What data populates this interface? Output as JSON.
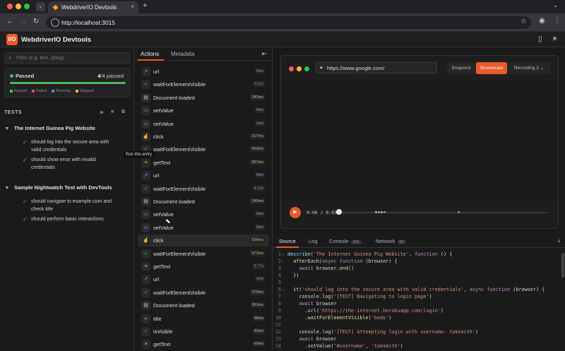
{
  "browser": {
    "tab_title": "WebdriverIO Devtools",
    "url": "http://localhost:3015",
    "new_tab": "+",
    "tab_close": "×",
    "tab_menu": "⌄"
  },
  "app": {
    "logo": "I/O",
    "title": "WebdriverIO Devtools"
  },
  "sidebar": {
    "filter_placeholder": "Filter (e.g. text, @tag)",
    "status": {
      "label": "Passed",
      "count_passed": "4",
      "count_total": "/4 passed",
      "progress": 1.0
    },
    "legend": [
      {
        "label": "Passed",
        "color": "#4cbb5c"
      },
      {
        "label": "Failed",
        "color": "#e04a4a"
      },
      {
        "label": "Running",
        "color": "#4a8be0"
      },
      {
        "label": "Skipped",
        "color": "#e0b84a"
      }
    ],
    "tests_header": "TESTS",
    "suites": [
      {
        "title": "The Internet Guinea Pig Website",
        "tests": [
          "should log into the secure area with valid credentials",
          "should show error with invalid credentials"
        ]
      },
      {
        "title": "Sample Nightwatch Test with DevTools",
        "tests": [
          "should navigate to example.com and check title",
          "should perform basic interactions"
        ]
      }
    ],
    "tooltip": "Run this entry"
  },
  "actions": {
    "tabs": [
      "Actions",
      "Metadata"
    ],
    "items": [
      {
        "name": "url",
        "dur": "0ms",
        "icon": "↗",
        "icon_color": "#6aa6ff",
        "dur_color": "#9a9a9a"
      },
      {
        "name": "waitForElementVisible",
        "dur": "4.11s",
        "icon": "✓",
        "icon_color": "#4cbb5c",
        "dur_color": "#e06060"
      },
      {
        "name": "Document loaded",
        "dur": "242ms",
        "icon": "▤",
        "icon_color": "#cccccc",
        "dur_color": "#8fd19e"
      },
      {
        "name": "setValue",
        "dur": "0ms",
        "icon": "▭",
        "icon_color": "#a78bfa",
        "dur_color": "#9a9a9a"
      },
      {
        "name": "setValue",
        "dur": "1ms",
        "icon": "▭",
        "icon_color": "#a78bfa",
        "dur_color": "#9a9a9a"
      },
      {
        "name": "click",
        "dur": "517ms",
        "icon": "☝",
        "icon_color": "#a78bfa",
        "dur_color": "#e6a16a"
      },
      {
        "name": "waitForElementVisible",
        "dur": "683ms",
        "icon": "✓",
        "icon_color": "#4cbb5c",
        "dur_color": "#e6a16a"
      },
      {
        "name": "getText",
        "dur": "867ms",
        "icon": "≡",
        "icon_color": "#e0b84a",
        "dur_color": "#e6a16a"
      },
      {
        "name": "url",
        "dur": "0ms",
        "icon": "↗",
        "icon_color": "#6aa6ff",
        "dur_color": "#9a9a9a"
      },
      {
        "name": "waitForElementVisible",
        "dur": "4.12s",
        "icon": "✓",
        "icon_color": "#4cbb5c",
        "dur_color": "#e06060"
      },
      {
        "name": "Document loaded",
        "dur": "245ms",
        "icon": "▤",
        "icon_color": "#cccccc",
        "dur_color": "#8fd19e"
      },
      {
        "name": "setValue",
        "dur": "0ms",
        "icon": "▭",
        "icon_color": "#a78bfa",
        "dur_color": "#9a9a9a"
      },
      {
        "name": "setValue",
        "dur": "0ms",
        "icon": "▭",
        "icon_color": "#a78bfa",
        "dur_color": "#9a9a9a"
      },
      {
        "name": "click",
        "dur": "636ms",
        "icon": "☝",
        "icon_color": "#a78bfa",
        "dur_color": "#e6a16a"
      },
      {
        "name": "waitForElementVisible",
        "dur": "671ms",
        "icon": "✓",
        "icon_color": "#4cbb5c",
        "dur_color": "#e6a16a"
      },
      {
        "name": "getText",
        "dur": "5.77s",
        "icon": "≡",
        "icon_color": "#e0b84a",
        "dur_color": "#e06060"
      },
      {
        "name": "url",
        "dur": "1ms",
        "icon": "↗",
        "icon_color": "#6aa6ff",
        "dur_color": "#9a9a9a"
      },
      {
        "name": "waitForElementVisible",
        "dur": "275ms",
        "icon": "✓",
        "icon_color": "#4cbb5c",
        "dur_color": "#8fd19e"
      },
      {
        "name": "Document loaded",
        "dur": "261ms",
        "icon": "▤",
        "icon_color": "#cccccc",
        "dur_color": "#8fd19e"
      },
      {
        "name": "title",
        "dur": "38ms",
        "icon": "‹›",
        "icon_color": "#cccccc",
        "dur_color": "#8fd19e"
      },
      {
        "name": "isVisible",
        "dur": "42ms",
        "icon": "✓",
        "icon_color": "#4cbb5c",
        "dur_color": "#8fd19e"
      },
      {
        "name": "getText",
        "dur": "60ms",
        "icon": "≡",
        "icon_color": "#e0b84a",
        "dur_color": "#8fd19e"
      }
    ]
  },
  "preview": {
    "url": "https://www.google.com/",
    "buttons": [
      "Snapshot",
      "Screencast",
      "Recording 2"
    ],
    "time": "0:00  /  0:03"
  },
  "devtools": {
    "tabs": [
      {
        "label": "Source",
        "badge": ""
      },
      {
        "label": "Log",
        "badge": ""
      },
      {
        "label": "Console",
        "badge": "141"
      },
      {
        "label": "Network",
        "badge": "62"
      }
    ]
  },
  "code": [
    {
      "n": "1",
      "fold": "⌄",
      "html": "<span class='v'>describe</span><span class='p'>(</span><span class='s'>'The Internet Guinea Pig Website'</span><span class='p'>, </span><span class='k'>function</span><span class='p'> () {</span>"
    },
    {
      "n": "2",
      "fold": "⌄",
      "html": "<span class='p'>  </span><span class='f'>afterEach</span><span class='p'>(</span><span class='k'>async function</span><span class='p'> (browser) {</span>"
    },
    {
      "n": "3",
      "fold": "",
      "html": "<span class='p'>    </span><span class='k'>await</span><span class='p'> browser.</span><span class='f'>end</span><span class='p'>()</span>"
    },
    {
      "n": "4",
      "fold": "",
      "html": "<span class='p'>  })</span>"
    },
    {
      "n": "5",
      "fold": "",
      "html": ""
    },
    {
      "n": "6",
      "fold": "⌄",
      "html": "<span class='p'>  </span><span class='f'>it</span><span class='p'>(</span><span class='s'>'should log into the secure area with valid credentials'</span><span class='p'>, </span><span class='k'>async function</span><span class='p'> (browser) {</span>"
    },
    {
      "n": "7",
      "fold": "",
      "html": "<span class='p'>    console.</span><span class='f'>log</span><span class='p'>(</span><span class='s'>'[TEST] Navigating to login page'</span><span class='p'>)</span>"
    },
    {
      "n": "8",
      "fold": "",
      "html": "<span class='p'>    </span><span class='k'>await</span><span class='p'> browser</span>"
    },
    {
      "n": "9",
      "fold": "",
      "html": "<span class='p'>      .</span><span class='f'>url</span><span class='p'>(</span><span class='s'>'https://the-internet.herokuapp.com/login'</span><span class='p'>)</span>"
    },
    {
      "n": "10",
      "fold": "",
      "html": "<span class='p'>      .</span><span class='f'>waitForElementVisible</span><span class='p'>(</span><span class='s'>'body'</span><span class='p'>)</span>"
    },
    {
      "n": "11",
      "fold": "",
      "html": ""
    },
    {
      "n": "12",
      "fold": "",
      "html": "<span class='p'>    console.</span><span class='f'>log</span><span class='p'>(</span><span class='s'>'[TEST] Attempting login with username: tomsmith'</span><span class='p'>)</span>"
    },
    {
      "n": "13",
      "fold": "",
      "html": "<span class='p'>    </span><span class='k'>await</span><span class='p'> browser</span>"
    },
    {
      "n": "14",
      "fold": "",
      "html": "<span class='p'>      .</span><span class='f'>setValue</span><span class='p'>(</span><span class='s'>'#username'</span><span class='p'>, </span><span class='s'>'tomsmith'</span><span class='p'>)</span>"
    }
  ],
  "colors": {
    "accent": "#ea5a29",
    "passed": "#4cbb5c"
  }
}
